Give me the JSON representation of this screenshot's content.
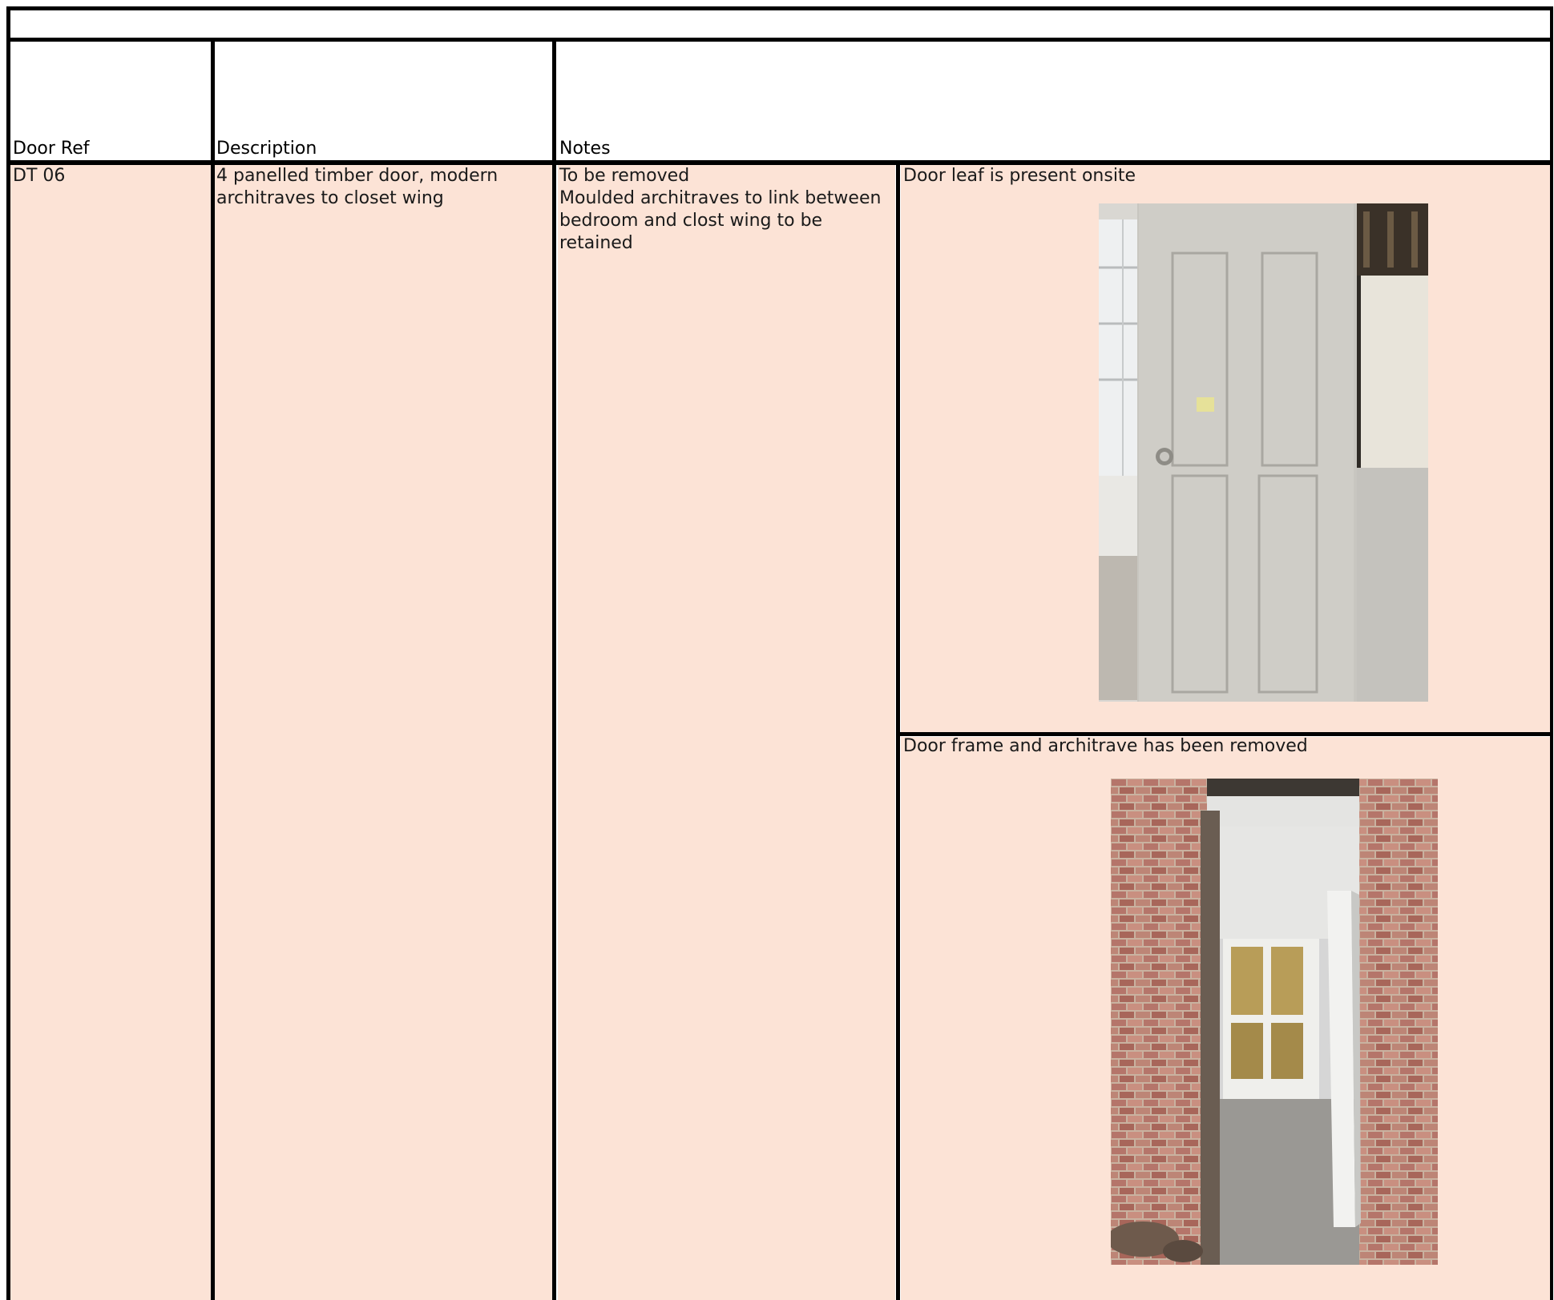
{
  "table": {
    "headers": {
      "door_ref": "Door Ref",
      "description": "Description",
      "notes": "Notes"
    },
    "row": {
      "door_ref": "DT 06",
      "description": "4 panelled timber door, modern architraves to closet wing",
      "notes": [
        "To be removed",
        "Moulded architraves to link between bedroom and clost wing to be retained"
      ],
      "photos": [
        {
          "caption": "Door leaf is present onsite",
          "subject": "door-leaf-photo"
        },
        {
          "caption": "Door frame and architrave has been removed",
          "subject": "doorway-photo"
        }
      ]
    }
  },
  "colors": {
    "row_fill": "#fce3d6",
    "grid_lines": "#000000"
  }
}
